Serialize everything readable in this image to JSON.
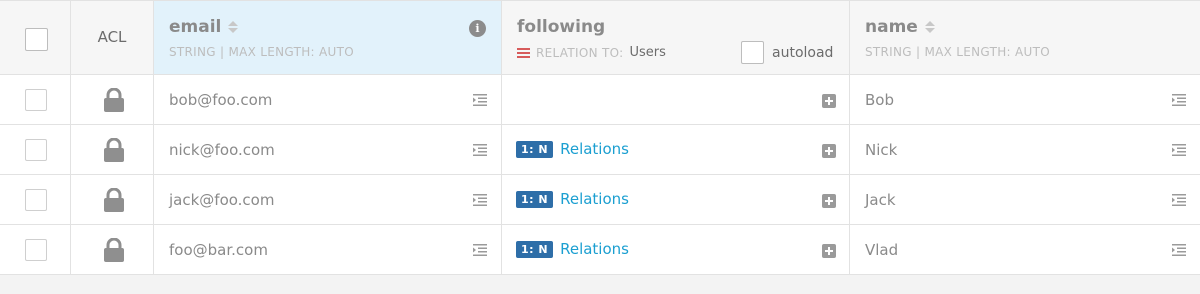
{
  "columns": {
    "acl": "ACL",
    "email": {
      "title": "email",
      "subtitle": "STRING | MAX LENGTH: AUTO",
      "info": "i"
    },
    "following": {
      "title": "following",
      "subtitle": "RELATION TO:",
      "target": "Users",
      "autoload_label": "autoload"
    },
    "name": {
      "title": "name",
      "subtitle": "STRING | MAX LENGTH: AUTO"
    }
  },
  "rows": [
    {
      "email": "bob@foo.com",
      "has_relations": false,
      "relation_badge": "",
      "relation_link": "",
      "name": "Bob"
    },
    {
      "email": "nick@foo.com",
      "has_relations": true,
      "relation_badge": "1: N",
      "relation_link": "Relations",
      "name": "Nick"
    },
    {
      "email": "jack@foo.com",
      "has_relations": true,
      "relation_badge": "1: N",
      "relation_link": "Relations",
      "name": "Jack"
    },
    {
      "email": "foo@bar.com",
      "has_relations": true,
      "relation_badge": "1: N",
      "relation_link": "Relations",
      "name": "Vlad"
    }
  ],
  "colors": {
    "header_highlight": "#e2f2fb",
    "badge": "#2e6ea8",
    "link": "#1b9fd1",
    "relation_icon": "#d75b5b"
  },
  "icons": {
    "lock": "lock-icon",
    "edit": "edit-icon",
    "add": "add-relation-icon",
    "sort": "sort-icon",
    "info": "info-icon"
  }
}
